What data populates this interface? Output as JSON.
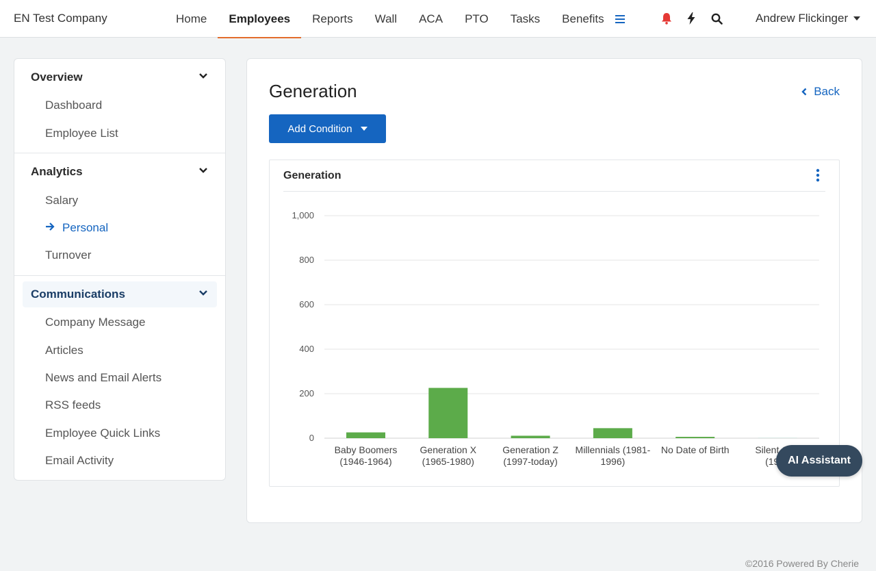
{
  "header": {
    "brand": "EN Test Company",
    "nav": [
      {
        "label": "Home",
        "active": false
      },
      {
        "label": "Employees",
        "active": true
      },
      {
        "label": "Reports",
        "active": false
      },
      {
        "label": "Wall",
        "active": false
      },
      {
        "label": "ACA",
        "active": false
      },
      {
        "label": "PTO",
        "active": false
      },
      {
        "label": "Tasks",
        "active": false
      },
      {
        "label": "Benefits",
        "active": false
      }
    ],
    "user_name": "Andrew Flickinger",
    "icons": [
      "hamburger-menu-icon",
      "bell-icon",
      "lightning-icon",
      "search-icon"
    ]
  },
  "sidebar": {
    "sections": [
      {
        "title": "Overview",
        "items": [
          "Dashboard",
          "Employee List"
        ]
      },
      {
        "title": "Analytics",
        "items": [
          "Salary",
          "Personal",
          "Turnover"
        ],
        "current": "Personal"
      },
      {
        "title": "Communications",
        "items": [
          "Company Message",
          "Articles",
          "News and Email Alerts",
          "RSS feeds",
          "Employee Quick Links",
          "Email Activity"
        ]
      }
    ]
  },
  "main": {
    "title": "Generation",
    "back_label": "Back",
    "add_condition_label": "Add Condition",
    "chart_card_title": "Generation"
  },
  "chart_data": {
    "type": "bar",
    "title": "Generation",
    "categories": [
      [
        "Baby Boomers",
        "(1946-1964)"
      ],
      [
        "Generation X",
        "(1965-1980)"
      ],
      [
        "Generation Z",
        "(1997-today)"
      ],
      [
        "Millennials (1981-",
        "1996)"
      ],
      [
        "No Date of Birth",
        ""
      ],
      [
        "Silent Gen",
        "(1925"
      ]
    ],
    "values": [
      26,
      226,
      11,
      45,
      6,
      2
    ],
    "ylim": [
      0,
      1000
    ],
    "yticks": [
      0,
      200,
      400,
      600,
      800,
      1000
    ],
    "ytick_labels": [
      "0",
      "200",
      "400",
      "600",
      "800",
      "1,000"
    ],
    "grid": true,
    "colors": {
      "bar": "#5cab4a",
      "last_bar": "#d9e9e4",
      "grid": "#e6e6e6"
    }
  },
  "footer": "©2016 Powered By Cherie",
  "ai_assistant_label": "AI Assistant",
  "colors": {
    "accent": "#1565c0",
    "nav_underline": "#e36c2c",
    "alert": "#e53935"
  }
}
